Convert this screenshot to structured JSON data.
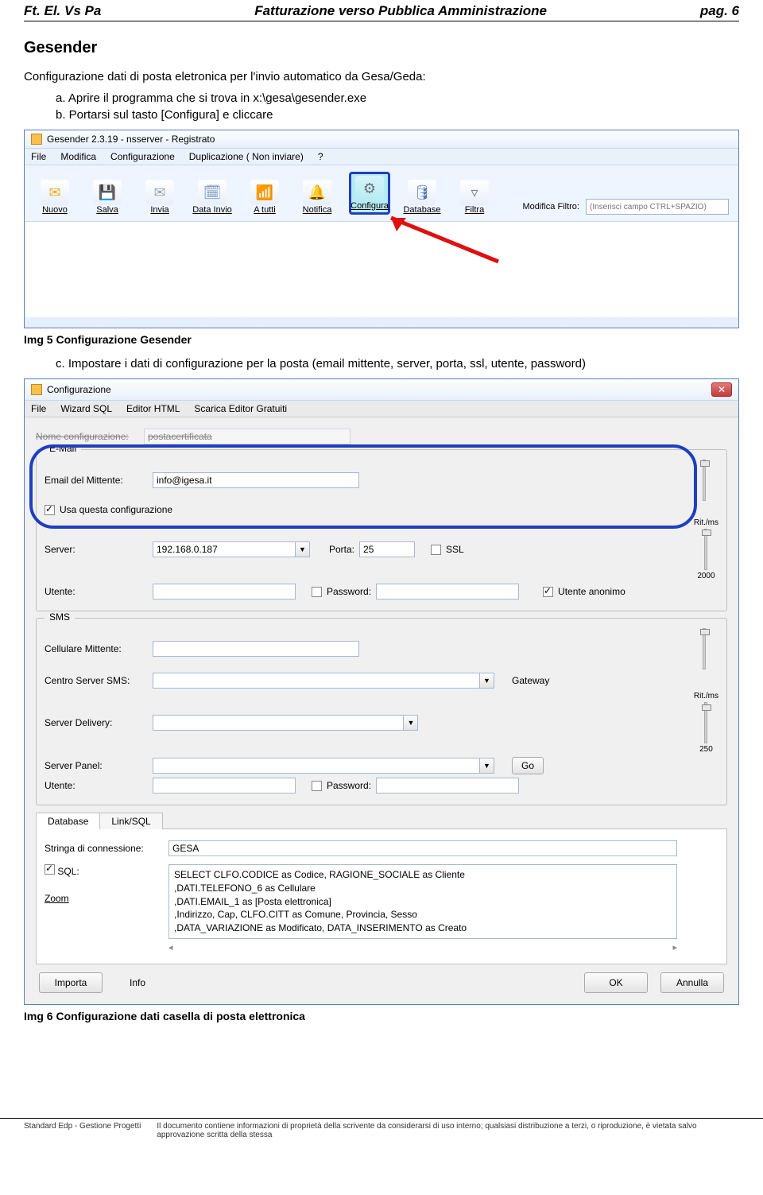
{
  "doc_header": {
    "left": "Ft. El. Vs Pa",
    "center": "Fatturazione verso Pubblica Amministrazione",
    "right": "pag. 6"
  },
  "section_title": "Gesender",
  "intro": "Configurazione dati di posta eletronica per l'invio automatico da Gesa/Geda:",
  "steps_ab": {
    "a": "a.  Aprire il programma che si trova in x:\\gesa\\gesender.exe",
    "b": "b.  Portarsi sul tasto [Configura] e cliccare"
  },
  "app": {
    "title": "Gesender 2.3.19 - nsserver - Registrato",
    "menu": [
      "File",
      "Modifica",
      "Configurazione",
      "Duplicazione ( Non inviare)",
      "?"
    ],
    "toolbar": [
      {
        "key": "Nuovo",
        "label": "Nuovo",
        "icon": "✉"
      },
      {
        "key": "Salva",
        "label": "Salva",
        "icon": "💾"
      },
      {
        "key": "Invia",
        "label": "Invia",
        "icon": "✉"
      },
      {
        "key": "DataInvio",
        "label": "Data Invio",
        "icon": "🗓"
      },
      {
        "key": "Atutti",
        "label": "A tutti",
        "icon": "📶"
      },
      {
        "key": "Notifica",
        "label": "Notifica",
        "icon": "🔔"
      },
      {
        "key": "Configura",
        "label": "Configura",
        "icon": "⚙"
      },
      {
        "key": "Database",
        "label": "Database",
        "icon": "🛢"
      },
      {
        "key": "Filtra",
        "label": "Filtra",
        "icon": "▾"
      }
    ],
    "filter_label": "Modifica Filtro:",
    "filter_placeholder": "(Inserisci campo CTRL+SPAZIO)"
  },
  "fig5_caption": "Img 5 Configurazione Gesender",
  "step_c": "c.   Impostare i dati di configurazione per la posta (email mittente, server, porta, ssl, utente, password)",
  "config": {
    "title": "Configurazione",
    "menu": [
      "File",
      "Wizard SQL",
      "Editor HTML",
      "Scarica Editor Gratuiti"
    ],
    "name_label": "Nome configurazione:",
    "name_value": "postacertificata",
    "email": {
      "legend": "E-Mail",
      "from_label": "Email del Mittente:",
      "from_value": "info@igesa.it",
      "use_config": "Usa questa configurazione",
      "server_label": "Server:",
      "server_value": "192.168.0.187",
      "port_label": "Porta:",
      "port_value": "25",
      "ssl_label": "SSL",
      "user_label": "Utente:",
      "user_value": "",
      "password_label": "Password:",
      "password_value": "",
      "anon_label": "Utente anonimo",
      "rit_label": "Rit./ms",
      "rit_value": "2000"
    },
    "sms": {
      "legend": "SMS",
      "cell_label": "Cellulare Mittente:",
      "center_label": "Centro Server SMS:",
      "gateway": "Gateway",
      "delivery_label": "Server Delivery:",
      "panel_label": "Server Panel:",
      "go": "Go",
      "user_label": "Utente:",
      "password_label": "Password:",
      "rit_label": "Rit./ms",
      "rit_value": "250"
    },
    "tabs": {
      "db": "Database",
      "link": "Link/SQL"
    },
    "db_panel": {
      "conn_label": "Stringa di connessione:",
      "conn_value": "GESA",
      "sql_label": "SQL:",
      "zoom_label": "Zoom",
      "sql_text": "SELECT CLFO.CODICE as Codice, RAGIONE_SOCIALE as Cliente\n,DATI.TELEFONO_6 as Cellulare\n,DATI.EMAIL_1 as [Posta elettronica]\n,Indirizzo, Cap, CLFO.CITT as Comune, Provincia, Sesso\n,DATA_VARIAZIONE as Modificato, DATA_INSERIMENTO as Creato"
    },
    "footer": {
      "import": "Importa",
      "info": "Info",
      "ok": "OK",
      "cancel": "Annulla"
    }
  },
  "fig6_caption": "Img 6 Configurazione dati casella di posta elettronica",
  "page_footer": {
    "left": "Standard Edp - Gestione Progetti",
    "right": "Il documento contiene informazioni di proprietà della scrivente da considerarsi di uso interno;\nqualsiasi distribuzione a terzi, o riproduzione, è vietata salvo approvazione scritta della stessa"
  }
}
